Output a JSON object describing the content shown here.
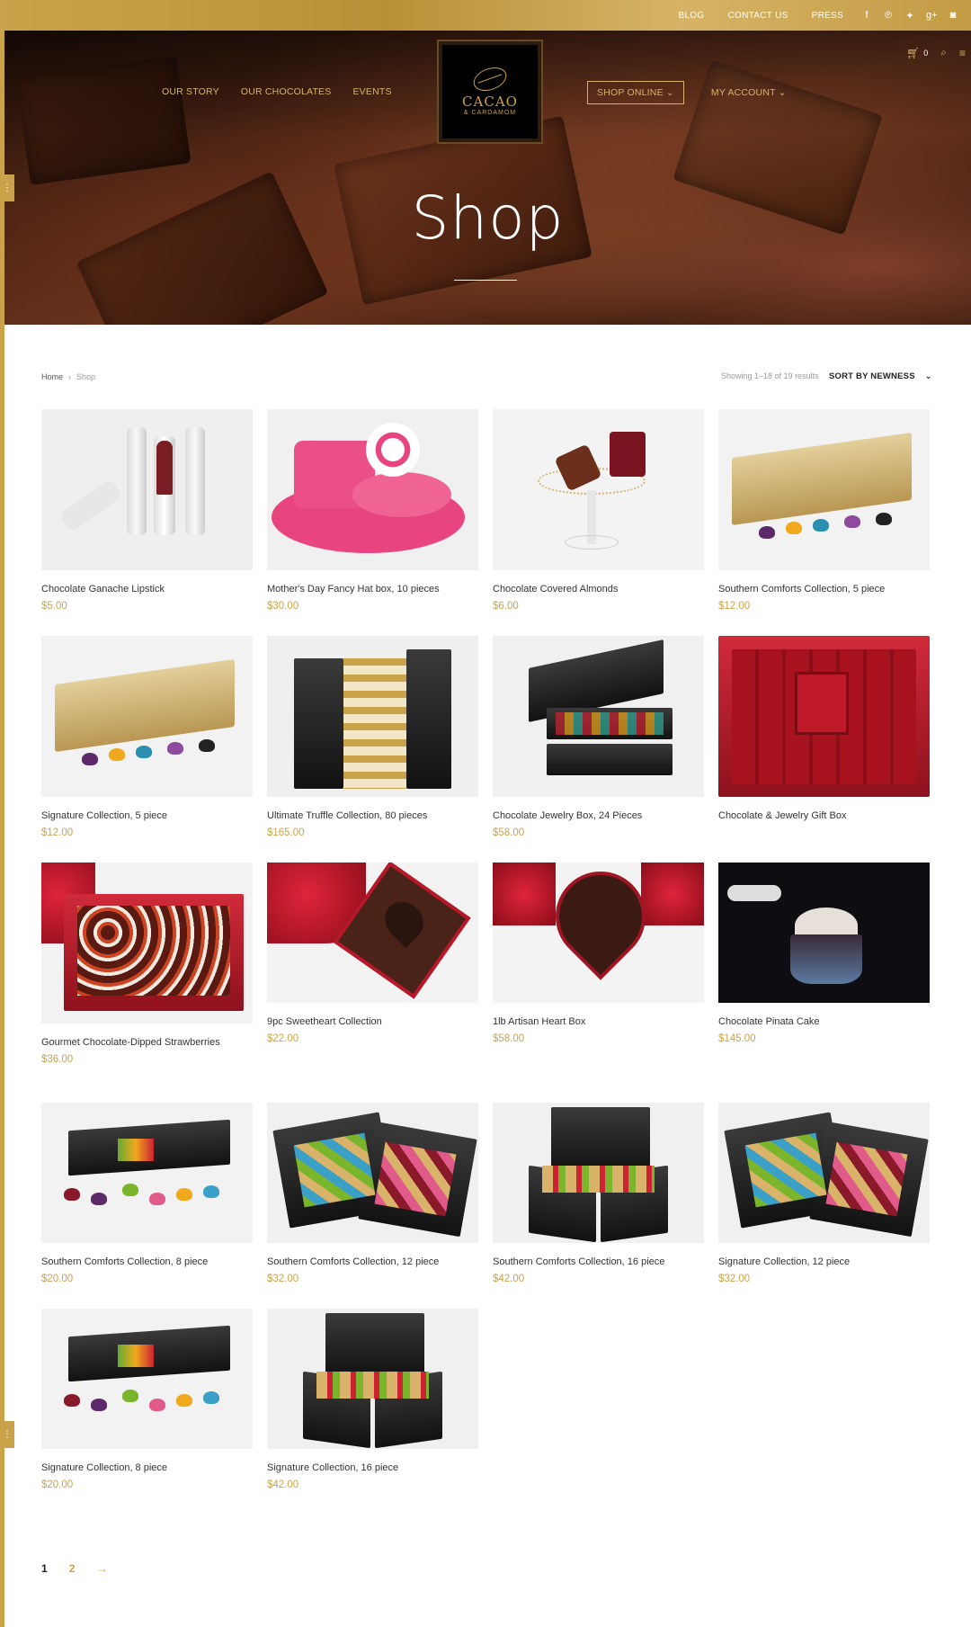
{
  "topbar": {
    "links": [
      "BLOG",
      "CONTACT US",
      "PRESS"
    ],
    "social": [
      "facebook-icon",
      "pinterest-icon",
      "twitter-icon",
      "google-plus-icon",
      "instagram-icon"
    ]
  },
  "nav": {
    "left": [
      "OUR STORY",
      "OUR CHOCOLATES",
      "EVENTS"
    ],
    "shop_online": "SHOP ONLINE",
    "my_account": "MY ACCOUNT",
    "cart_count": "0"
  },
  "logo": {
    "text": "CACAO",
    "sub": "& CARDAMOM"
  },
  "hero": {
    "title": "Shop"
  },
  "breadcrumb": {
    "home": "Home",
    "current": "Shop"
  },
  "results": {
    "count_text": "Showing 1–18 of 19 results",
    "sort_label": "SORT BY NEWNESS"
  },
  "products": [
    {
      "name": "Chocolate Ganache Lipstick",
      "price": "$5.00"
    },
    {
      "name": "Mother's Day Fancy Hat box, 10 pieces",
      "price": "$30.00"
    },
    {
      "name": "Chocolate Covered Almonds",
      "price": "$6.00"
    },
    {
      "name": "Southern Comforts Collection, 5 piece",
      "price": "$12.00"
    },
    {
      "name": "Signature Collection, 5 piece",
      "price": "$12.00"
    },
    {
      "name": "Ultimate Truffle Collection, 80 pieces",
      "price": "$165.00"
    },
    {
      "name": "Chocolate Jewelry Box, 24 Pieces",
      "price": "$58.00"
    },
    {
      "name": "Chocolate & Jewelry Gift Box",
      "price": ""
    },
    {
      "name": "Gourmet Chocolate-Dipped Strawberries",
      "price": "$36.00"
    },
    {
      "name": "9pc Sweetheart Collection",
      "price": "$22.00"
    },
    {
      "name": "1lb Artisan Heart Box",
      "price": "$58.00"
    },
    {
      "name": "Chocolate Pinata Cake",
      "price": "$145.00"
    },
    {
      "name": "Southern Comforts Collection, 8 piece",
      "price": "$20.00"
    },
    {
      "name": "Southern Comforts Collection, 12 piece",
      "price": "$32.00"
    },
    {
      "name": "Southern Comforts Collection, 16 piece",
      "price": "$42.00"
    },
    {
      "name": "Signature Collection, 12 piece",
      "price": "$32.00"
    },
    {
      "name": "Signature Collection, 8 piece",
      "price": "$20.00"
    },
    {
      "name": "Signature Collection, 16 piece",
      "price": "$42.00"
    }
  ],
  "pagination": {
    "current": "1",
    "next_page": "2",
    "next_arrow": "→"
  },
  "colors": {
    "gold": "#c9a24a",
    "dark": "#222222"
  }
}
